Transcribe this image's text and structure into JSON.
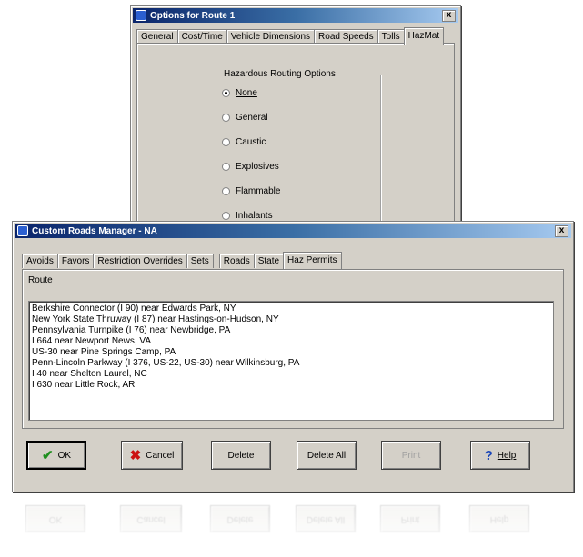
{
  "options_window": {
    "title": "Options for Route 1",
    "close_glyph": "x",
    "tabs": [
      "General",
      "Cost/Time",
      "Vehicle Dimensions",
      "Road Speeds",
      "Tolls",
      "HazMat"
    ],
    "group_label": "Hazardous Routing Options",
    "radios": [
      {
        "label": "None",
        "checked": true
      },
      {
        "label": "General",
        "checked": false
      },
      {
        "label": "Caustic",
        "checked": false
      },
      {
        "label": "Explosives",
        "checked": false
      },
      {
        "label": "Flammable",
        "checked": false
      },
      {
        "label": "Inhalants",
        "checked": false
      }
    ]
  },
  "manager_window": {
    "title": "Custom Roads Manager - NA",
    "close_glyph": "x",
    "tabs": [
      "Avoids",
      "Favors",
      "Restriction Overrides",
      "Sets",
      "Roads",
      "State",
      "Haz Permits"
    ],
    "list_header": "Route",
    "routes": [
      "Berkshire Connector (I 90) near Edwards Park, NY",
      "New York State Thruway (I 87) near Hastings-on-Hudson, NY",
      "Pennsylvania Turnpike (I 76) near Newbridge, PA",
      "I 664 near Newport News, VA",
      "US-30 near Pine Springs Camp, PA",
      "Penn-Lincoln Parkway (I 376, US-22, US-30) near Wilkinsburg, PA",
      "I 40 near Shelton Laurel, NC",
      "I 630 near Little Rock, AR"
    ],
    "buttons": {
      "ok": "OK",
      "cancel": "Cancel",
      "delete": "Delete",
      "delete_all": "Delete All",
      "print": "Print",
      "help": "Help"
    }
  },
  "colors": {
    "title_bar_start": "#0a246a",
    "title_bar_end": "#a6caf0",
    "dialog_face": "#d4d0c8",
    "ok_check": "#1f8f1f",
    "cancel_x": "#cc1111",
    "help_question": "#1a46b8"
  },
  "icons": {
    "ok": "check-icon",
    "cancel": "x-icon",
    "help": "question-icon"
  }
}
